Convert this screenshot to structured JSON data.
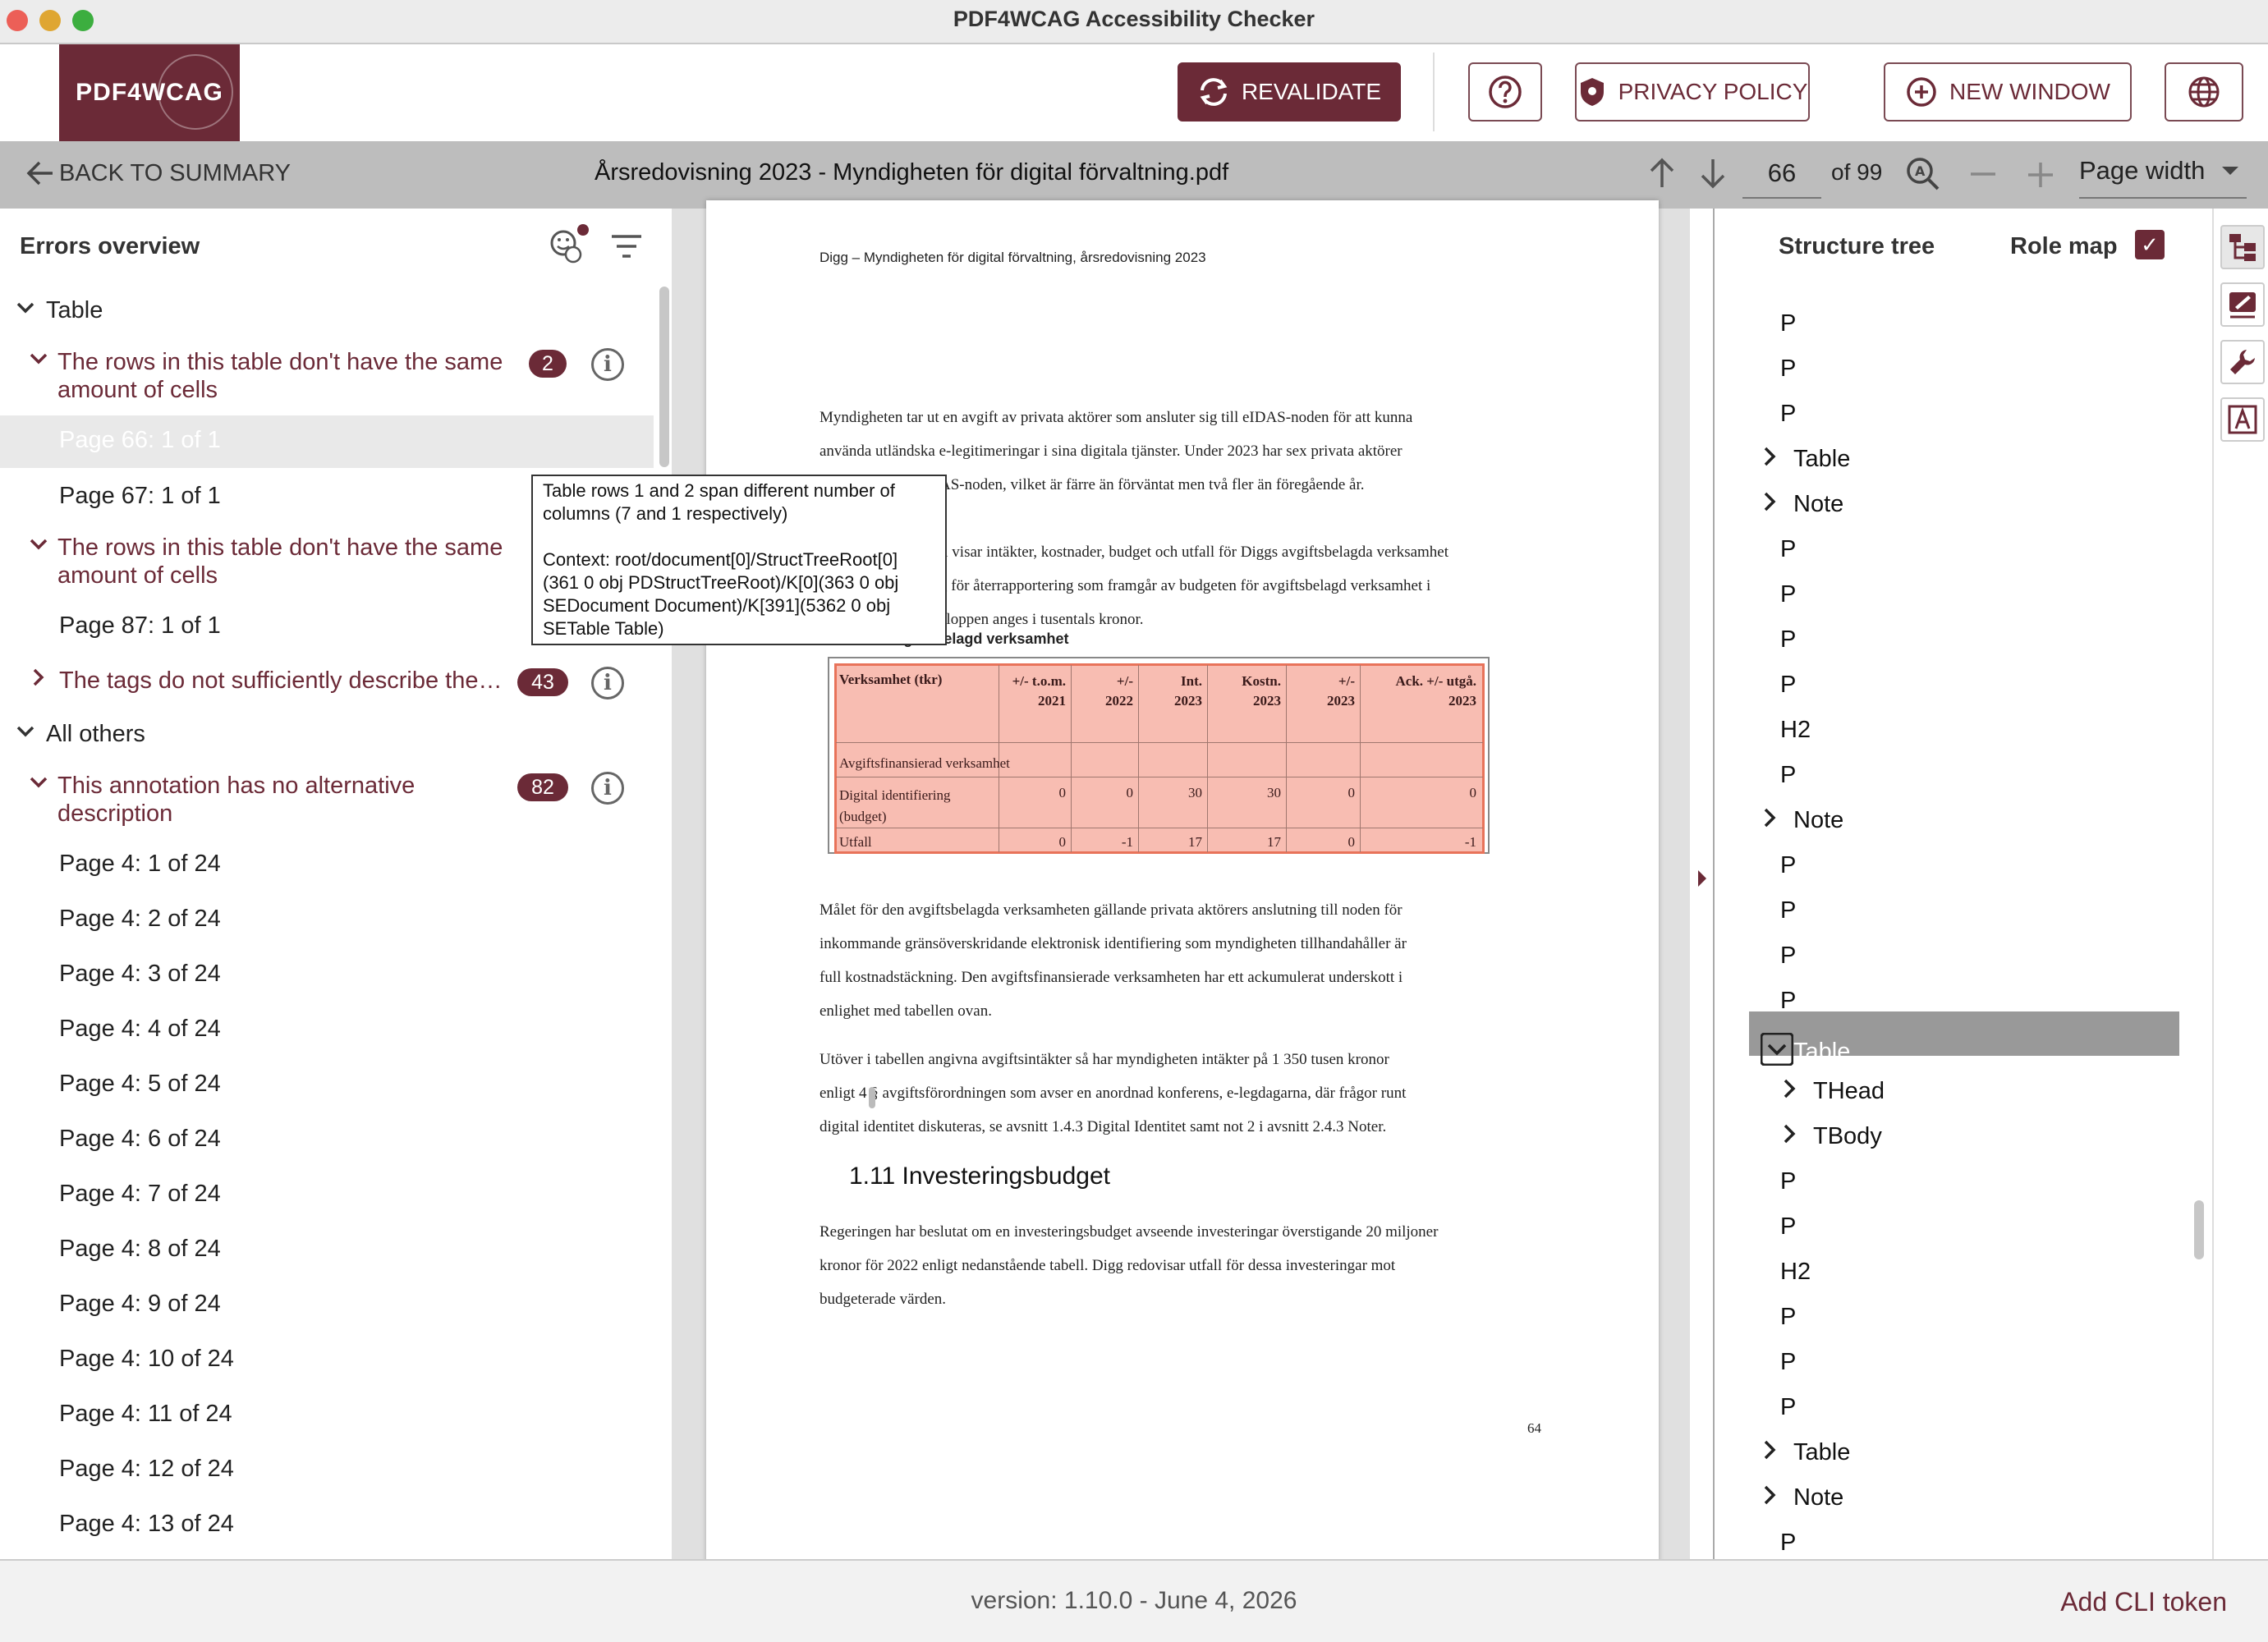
{
  "window": {
    "title": "PDF4WCAG Accessibility Checker"
  },
  "header": {
    "logo_text": "PDF4WCAG",
    "revalidate": "REVALIDATE",
    "privacy": "PRIVACY POLICY",
    "new_window": "NEW WINDOW"
  },
  "toolbar": {
    "back": "BACK TO SUMMARY",
    "doc_title": "Årsredovisning 2023 - Myndigheten för digital förvaltning.pdf",
    "page": "66",
    "page_of": "of 99",
    "zoom": "Page width"
  },
  "errors": {
    "title": "Errors overview",
    "group_table": "Table",
    "err1": {
      "label": "The rows in this table don't have the same amount of cells",
      "count": "2"
    },
    "err1_pages": [
      "Page 66: 1 of 1",
      "Page 67: 1 of 1"
    ],
    "err2": {
      "label": "The rows in this table don't have the same amount of cells"
    },
    "err2_pages": [
      "Page 87: 1 of 1"
    ],
    "err3": {
      "label": "The tags do not sufficiently describe the…",
      "count": "43"
    },
    "group_others": "All others",
    "err4": {
      "label": "This annotation has no alternative description",
      "count": "82"
    },
    "err4_pages": [
      "Page 4: 1 of 24",
      "Page 4: 2 of 24",
      "Page 4: 3 of 24",
      "Page 4: 4 of 24",
      "Page 4: 5 of 24",
      "Page 4: 6 of 24",
      "Page 4: 7 of 24",
      "Page 4: 8 of 24",
      "Page 4: 9 of 24",
      "Page 4: 10 of 24",
      "Page 4: 11 of 24",
      "Page 4: 12 of 24",
      "Page 4: 13 of 24"
    ]
  },
  "tooltip": {
    "line1": "Table rows 1 and 2 span different number of",
    "line2": "columns (7 and 1 respectively)",
    "line3": "Context: root/document[0]/StructTreeRoot[0]",
    "line4": "(361 0 obj PDStructTreeRoot)/K[0](363 0 obj",
    "line5": "SEDocument Document)/K[391](5362 0 obj",
    "line6": "SETable Table)"
  },
  "pdf": {
    "header": "Digg – Myndigheten för digital förvaltning, årsredovisning 2023",
    "p1": [
      "Myndigheten tar ut en avgift av privata aktörer som ansluter sig till eIDAS-noden för att kunna",
      "använda utländska e-legitimeringar i sina digitala tjänster. Under 2023 har sex privata aktörer",
      "AS-noden, vilket är färre än förväntat men två fler än föregående år."
    ],
    "p2": [
      "ll visar intäkter, kostnader, budget och utfall för Diggs avgiftsbelagda verksamhet",
      "g för återrapportering som framgår av budgeten för avgiftsbelagd verksamhet i",
      "eloppen anges i tusentals kronor."
    ],
    "table_caption": "Tabell 10       Avgiftsbelagd verksamhet",
    "table_headers": [
      "Verksamhet (tkr)",
      "+/- t.o.m.\n2021",
      "+/-\n2022",
      "Int.\n2023",
      "Kostn.\n2023",
      "+/-\n2023",
      "Ack. +/- utgå.\n2023"
    ],
    "table_section": "Avgiftsfinansierad verksamhet",
    "table_rows": [
      {
        "label": "Digital identifiering\n(budget)",
        "values": [
          "0",
          "0",
          "30",
          "30",
          "0",
          "0"
        ]
      },
      {
        "label": "Utfall",
        "values": [
          "0",
          "-1",
          "17",
          "17",
          "0",
          "-1"
        ]
      }
    ],
    "p3": [
      "Målet för den avgiftsbelagda verksamheten gällande privata aktörers anslutning till noden för",
      "inkommande gränsöverskridande elektronisk identifiering som myndigheten tillhandahåller är",
      "full kostnadstäckning. Den avgiftsfinansierade verksamheten har ett ackumulerat underskott i",
      "enlighet med tabellen ovan."
    ],
    "p4": [
      "Utöver i tabellen angivna avgiftsintäkter så har myndigheten intäkter på 1 350 tusen kronor",
      "enligt 4 § avgiftsförordningen som avser en anordnad konferens, e-legdagarna, där frågor runt",
      "digital identitet diskuteras, se avsnitt 1.4.3 Digital Identitet samt not 2 i avsnitt 2.4.3 Noter."
    ],
    "heading": "1.11 Investeringsbudget",
    "p5": [
      "Regeringen har beslutat om en investeringsbudget avseende investeringar överstigande 20 miljoner",
      "kronor för 2022 enligt nedanstående tabell. Digg redovisar utfall för dessa investeringar mot",
      "budgeterade värden."
    ],
    "page_number": "64"
  },
  "structure": {
    "title": "Structure tree",
    "rolemap": "Role map",
    "items": [
      {
        "label": "P",
        "chev": ""
      },
      {
        "label": "P",
        "chev": ""
      },
      {
        "label": "P",
        "chev": ""
      },
      {
        "label": "Table",
        "chev": "›"
      },
      {
        "label": "Note",
        "chev": "›"
      },
      {
        "label": "P",
        "chev": ""
      },
      {
        "label": "P",
        "chev": ""
      },
      {
        "label": "P",
        "chev": ""
      },
      {
        "label": "P",
        "chev": ""
      },
      {
        "label": "H2",
        "chev": ""
      },
      {
        "label": "P",
        "chev": ""
      },
      {
        "label": "Note",
        "chev": "›"
      },
      {
        "label": "P",
        "chev": ""
      },
      {
        "label": "P",
        "chev": ""
      },
      {
        "label": "P",
        "chev": ""
      },
      {
        "label": "P",
        "chev": ""
      },
      {
        "label": "Table",
        "chev": "˅"
      },
      {
        "label": "THead",
        "chev": "›"
      },
      {
        "label": "TBody",
        "chev": "›"
      },
      {
        "label": "P",
        "chev": ""
      },
      {
        "label": "P",
        "chev": ""
      },
      {
        "label": "H2",
        "chev": ""
      },
      {
        "label": "P",
        "chev": ""
      },
      {
        "label": "P",
        "chev": ""
      },
      {
        "label": "P",
        "chev": ""
      },
      {
        "label": "Table",
        "chev": "›"
      },
      {
        "label": "Note",
        "chev": "›"
      },
      {
        "label": "P",
        "chev": ""
      }
    ]
  },
  "footer": {
    "version": "version: 1.10.0 - June 4, 2026",
    "cli": "Add CLI token"
  },
  "colors": {
    "brand": "#6b2a37",
    "highlight": "#f38773"
  }
}
